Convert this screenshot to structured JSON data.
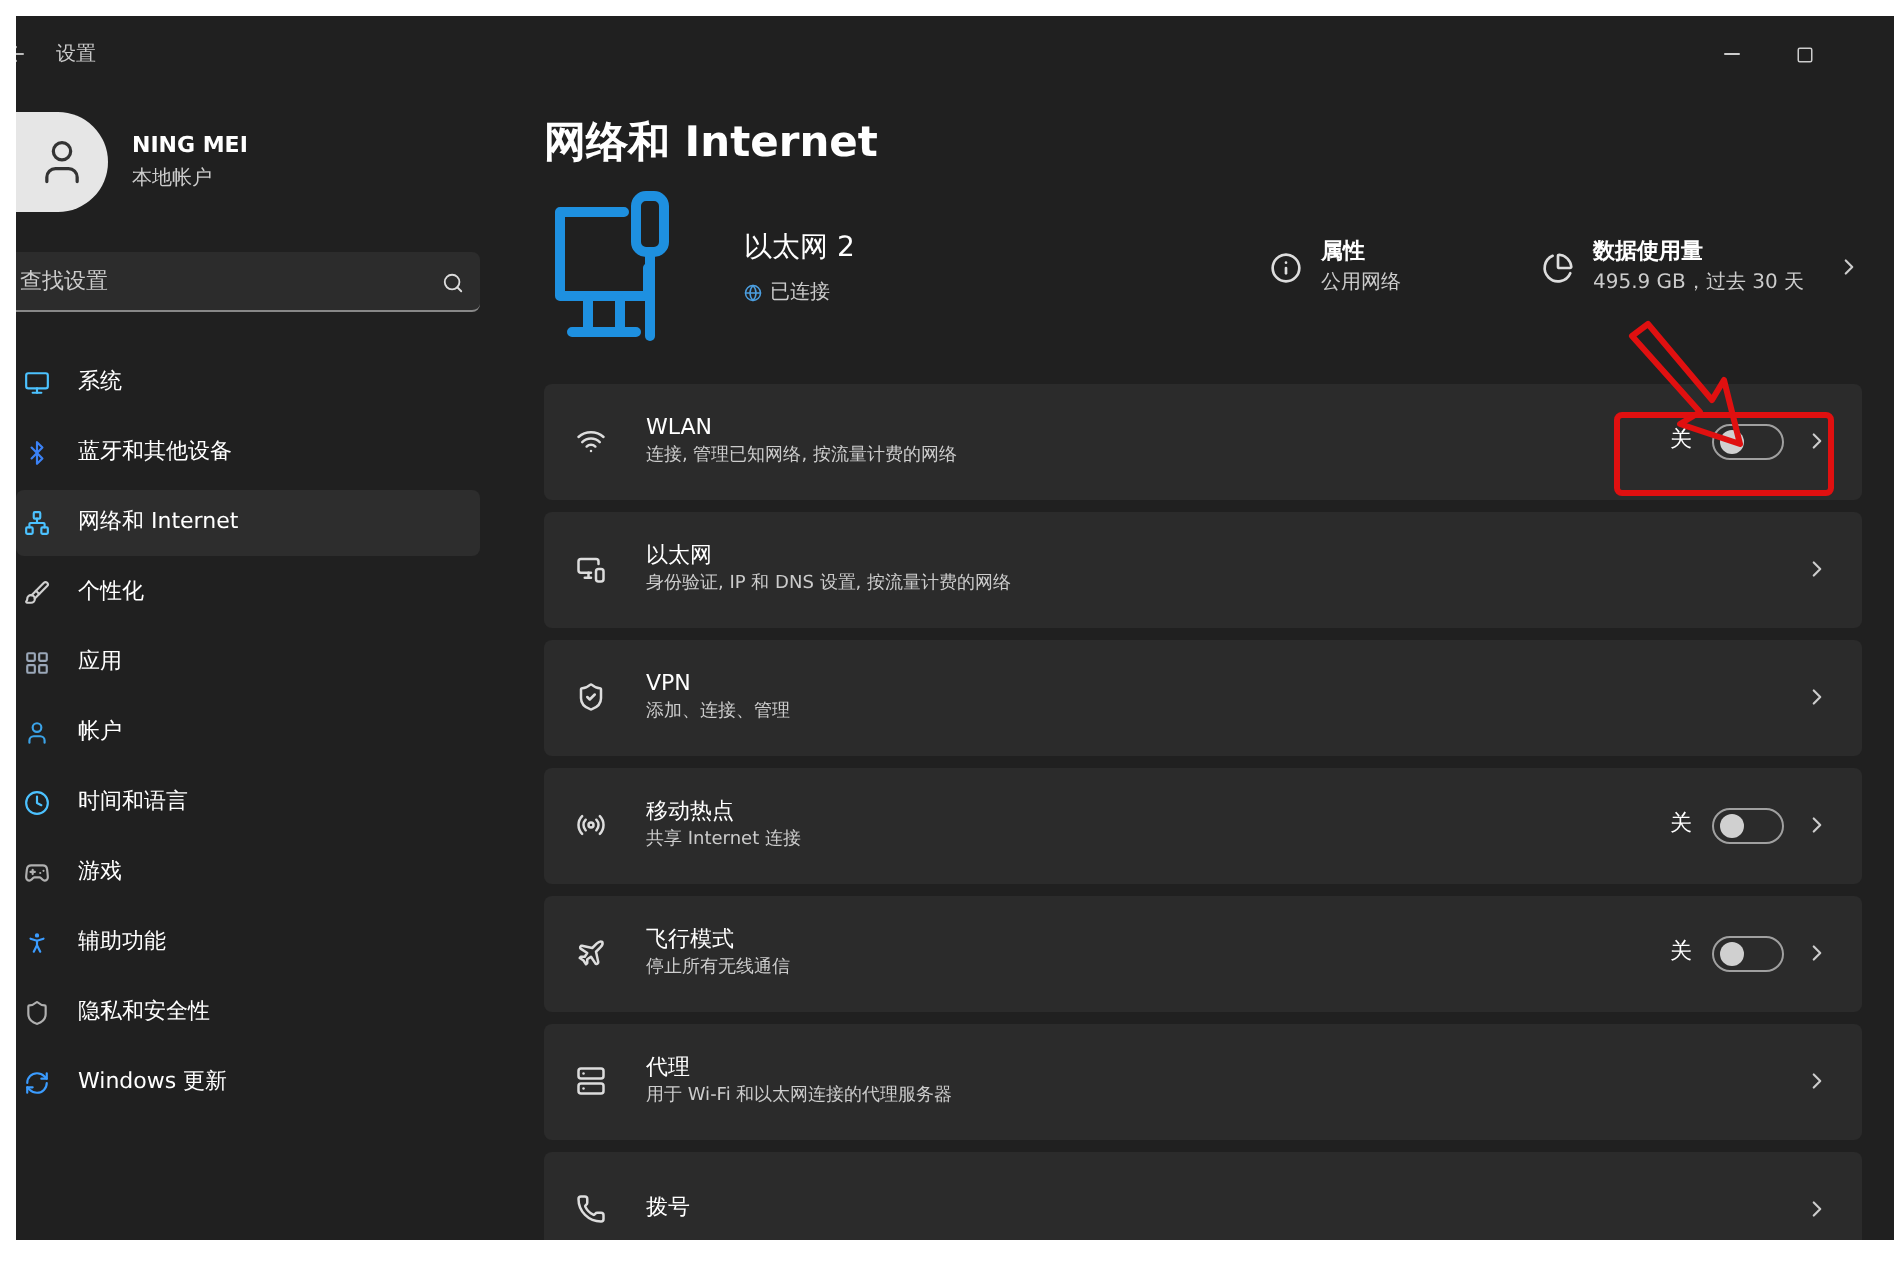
{
  "window": {
    "title": "设置"
  },
  "account": {
    "name": "NING MEI",
    "type": "本地帐户"
  },
  "search": {
    "placeholder": "查找设置"
  },
  "sidebar": {
    "items": [
      {
        "label": "系统",
        "selected": false
      },
      {
        "label": "蓝牙和其他设备",
        "selected": false
      },
      {
        "label": "网络和 Internet",
        "selected": true
      },
      {
        "label": "个性化",
        "selected": false
      },
      {
        "label": "应用",
        "selected": false
      },
      {
        "label": "帐户",
        "selected": false
      },
      {
        "label": "时间和语言",
        "selected": false
      },
      {
        "label": "游戏",
        "selected": false
      },
      {
        "label": "辅助功能",
        "selected": false
      },
      {
        "label": "隐私和安全性",
        "selected": false
      },
      {
        "label": "Windows 更新",
        "selected": false
      }
    ]
  },
  "page": {
    "title": "网络和 Internet"
  },
  "connection": {
    "name": "以太网 2",
    "status": "已连接"
  },
  "properties": {
    "title": "属性",
    "subtitle": "公用网络"
  },
  "data_usage": {
    "title": "数据使用量",
    "subtitle": "495.9 GB，过去 30 天"
  },
  "rows": [
    {
      "title": "WLAN",
      "subtitle": "连接, 管理已知网络, 按流量计费的网络",
      "kind": "toggle",
      "on": false,
      "state_label": "关",
      "highlighted": true
    },
    {
      "title": "以太网",
      "subtitle": "身份验证, IP 和 DNS 设置, 按流量计费的网络",
      "kind": "link"
    },
    {
      "title": "VPN",
      "subtitle": "添加、连接、管理",
      "kind": "link"
    },
    {
      "title": "移动热点",
      "subtitle": "共享 Internet 连接",
      "kind": "toggle",
      "on": false,
      "state_label": "关",
      "highlighted": false
    },
    {
      "title": "飞行模式",
      "subtitle": "停止所有无线通信",
      "kind": "toggle",
      "on": false,
      "state_label": "关",
      "highlighted": false
    },
    {
      "title": "代理",
      "subtitle": "用于 Wi-Fi 和以太网连接的代理服务器",
      "kind": "link"
    },
    {
      "title": "拨号",
      "kind": "link"
    }
  ]
}
